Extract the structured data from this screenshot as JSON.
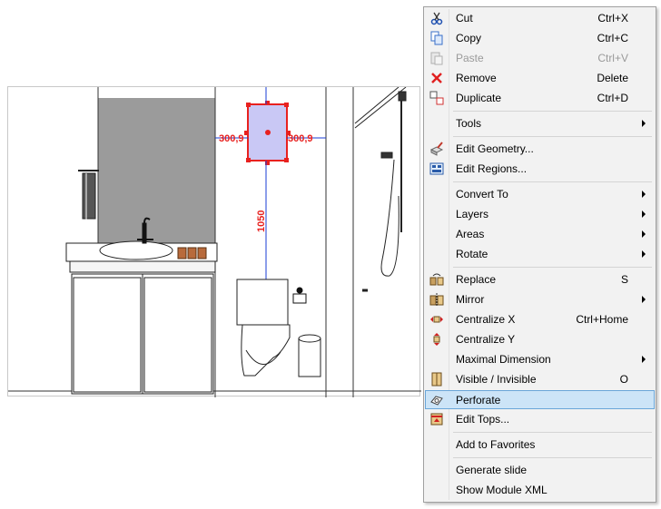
{
  "menu": {
    "items": [
      {
        "label": "Cut",
        "shortcut": "Ctrl+X",
        "icon": "scissors-icon"
      },
      {
        "label": "Copy",
        "shortcut": "Ctrl+C",
        "icon": "copy-icon"
      },
      {
        "label": "Paste",
        "shortcut": "Ctrl+V",
        "icon": "paste-icon",
        "disabled": true
      },
      {
        "label": "Remove",
        "shortcut": "Delete",
        "icon": "remove-x-icon"
      },
      {
        "label": "Duplicate",
        "shortcut": "Ctrl+D",
        "icon": "duplicate-icon"
      },
      {
        "label": "Tools",
        "submenu": true
      },
      {
        "label": "Edit Geometry...",
        "icon": "edit-geometry-icon"
      },
      {
        "label": "Edit Regions...",
        "icon": "edit-regions-icon"
      },
      {
        "label": "Convert To",
        "submenu": true
      },
      {
        "label": "Layers",
        "submenu": true
      },
      {
        "label": "Areas",
        "submenu": true
      },
      {
        "label": "Rotate",
        "submenu": true
      },
      {
        "label": "Replace",
        "shortcut": "S",
        "icon": "replace-icon"
      },
      {
        "label": "Mirror",
        "submenu": true,
        "icon": "mirror-icon"
      },
      {
        "label": "Centralize X",
        "shortcut": "Ctrl+Home",
        "icon": "centralize-x-icon"
      },
      {
        "label": "Centralize Y",
        "icon": "centralize-y-icon"
      },
      {
        "label": "Maximal Dimension",
        "submenu": true
      },
      {
        "label": "Visible / Invisible",
        "shortcut": "O",
        "icon": "visibility-icon"
      },
      {
        "label": "Perforate",
        "icon": "perforate-icon",
        "active": true
      },
      {
        "label": "Edit Tops...",
        "icon": "edit-tops-icon"
      },
      {
        "label": "Add to Favorites"
      },
      {
        "label": "Generate slide"
      },
      {
        "label": "Show Module XML"
      }
    ]
  },
  "drawing": {
    "dim_left": "300,9",
    "dim_right": "300,9",
    "dim_vertical": "1050"
  },
  "colors": {
    "menu_bg": "#f2f2f2",
    "highlight": "#cce4f7",
    "dimension": "#e8211f",
    "selected_box": "#c9c8f5",
    "wall_dark": "#9b9b9b"
  }
}
